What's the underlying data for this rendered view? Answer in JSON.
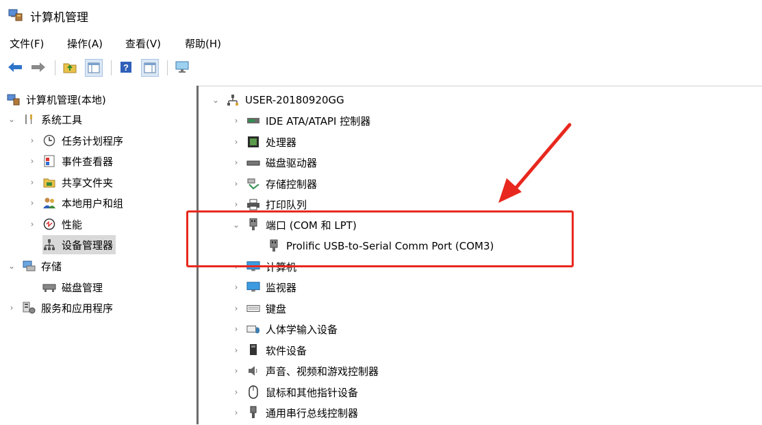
{
  "window": {
    "title": "计算机管理"
  },
  "menu": {
    "file": "文件(F)",
    "action": "操作(A)",
    "view": "查看(V)",
    "help": "帮助(H)"
  },
  "toolbar": {
    "icons": [
      "back-arrow-icon",
      "forward-arrow-icon",
      "up-folder-icon",
      "show-hide-tree-icon",
      "help-icon",
      "properties-icon",
      "computer-monitor-icon"
    ]
  },
  "left_tree": {
    "root": "计算机管理(本地)",
    "system_tools": "系统工具",
    "task_scheduler": "任务计划程序",
    "event_viewer": "事件查看器",
    "shared_folders": "共享文件夹",
    "local_users": "本地用户和组",
    "performance": "性能",
    "device_manager": "设备管理器",
    "storage": "存储",
    "disk_management": "磁盘管理",
    "services_apps": "服务和应用程序"
  },
  "device_tree": {
    "root": "USER-20180920GG",
    "ide": "IDE ATA/ATAPI 控制器",
    "processor": "处理器",
    "disk_drives": "磁盘驱动器",
    "storage_controllers": "存储控制器",
    "print_queues": "打印队列",
    "ports": "端口 (COM 和 LPT)",
    "port_device": "Prolific USB-to-Serial Comm Port (COM3)",
    "computer": "计算机",
    "monitors": "监视器",
    "keyboards": "键盘",
    "hid": "人体学输入设备",
    "software_devices": "软件设备",
    "audio": "声音、视频和游戏控制器",
    "mice": "鼠标和其他指针设备",
    "usb": "通用串行总线控制器"
  },
  "annotation": {
    "color": "#e8281e"
  }
}
